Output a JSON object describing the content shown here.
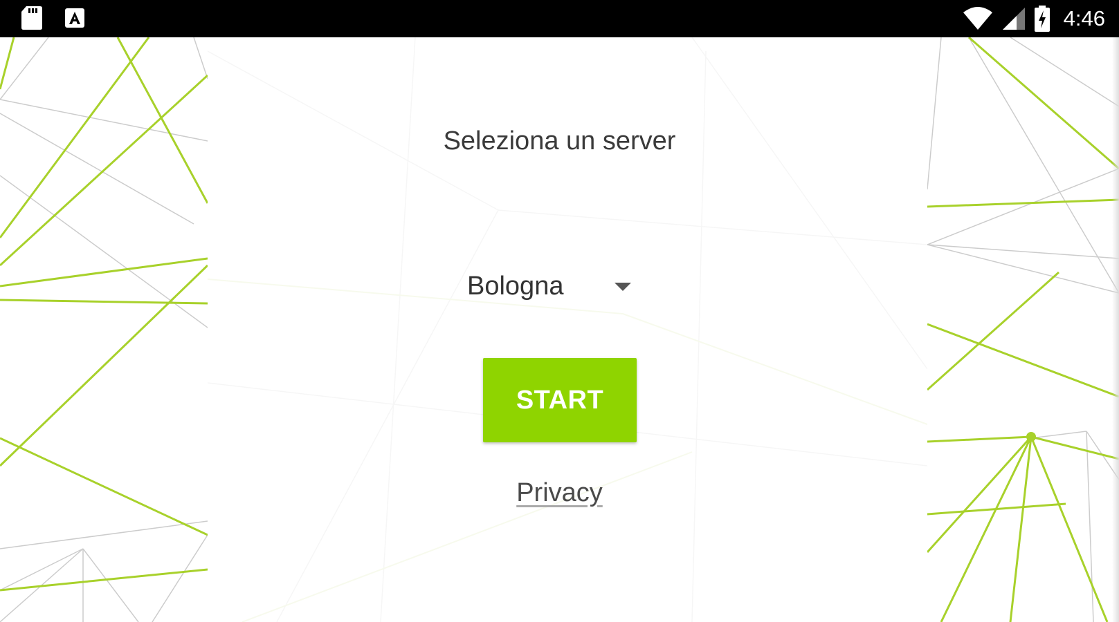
{
  "status_bar": {
    "left_icons": [
      "sd-card-icon",
      "app-store-icon"
    ],
    "right_icons": [
      "wifi-icon",
      "cell-signal-icon",
      "battery-charging-icon"
    ],
    "time": "4:46"
  },
  "main": {
    "title": "Seleziona un server",
    "server_select": {
      "selected": "Bologna"
    },
    "start_button_label": "START",
    "privacy_link": "Privacy"
  },
  "colors": {
    "accent": "#8fd400",
    "background": "#ffffff",
    "status_bar": "#000000"
  }
}
